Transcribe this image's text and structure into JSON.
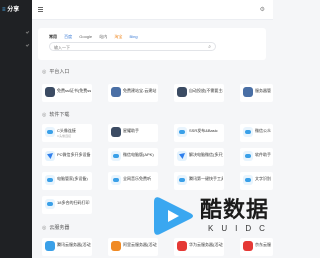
{
  "sidebar": {
    "logo_suffix": "分享",
    "items": [
      "",
      "",
      ""
    ]
  },
  "search": {
    "tabs": [
      "常用",
      "百度",
      "Google",
      "站内",
      "淘宝",
      "Bing"
    ],
    "placeholder": "输入一下"
  },
  "sections": {
    "platform": "平台入口",
    "software": "软件下载",
    "cloud": "云服务器"
  },
  "platform_cards": [
    {
      "title": "免费ssl证书(免费ssl证书)",
      "desc": ""
    },
    {
      "title": "免费建站宝-云建站",
      "desc": ""
    },
    {
      "title": "自动投放(不需要主机)",
      "desc": ""
    },
    {
      "title": "服务器管理",
      "desc": ""
    }
  ],
  "software_cards": [
    {
      "title": "C头像连接",
      "desc": "C头像连接"
    },
    {
      "title": "星耀助手",
      "desc": ""
    },
    {
      "title": "SSR发布&Basic",
      "desc": ""
    },
    {
      "title": "微信公众号",
      "desc": ""
    },
    {
      "title": "PC微信多开多设备",
      "desc": ""
    },
    {
      "title": "微信电脑版(APK)",
      "desc": ""
    },
    {
      "title": "解决电脑微信(多开)",
      "desc": ""
    },
    {
      "title": "软件助手",
      "desc": ""
    },
    {
      "title": "电脑管家(多设备)",
      "desc": ""
    },
    {
      "title": "全网音乐免费听",
      "desc": ""
    },
    {
      "title": "腾讯第一键快手工具",
      "desc": ""
    },
    {
      "title": "文字识别工具",
      "desc": ""
    },
    {
      "title": "18多合的扫码打印",
      "desc": ""
    }
  ],
  "cloud_cards": [
    {
      "title": "腾讯云服务器(活动)",
      "desc": ""
    },
    {
      "title": "阿里云服务器(活动)",
      "desc": ""
    },
    {
      "title": "华为云服务器(活动)",
      "desc": ""
    },
    {
      "title": "京东云服务器",
      "desc": ""
    }
  ],
  "watermark": {
    "text": "酷数据",
    "sub": "KUIDC"
  }
}
